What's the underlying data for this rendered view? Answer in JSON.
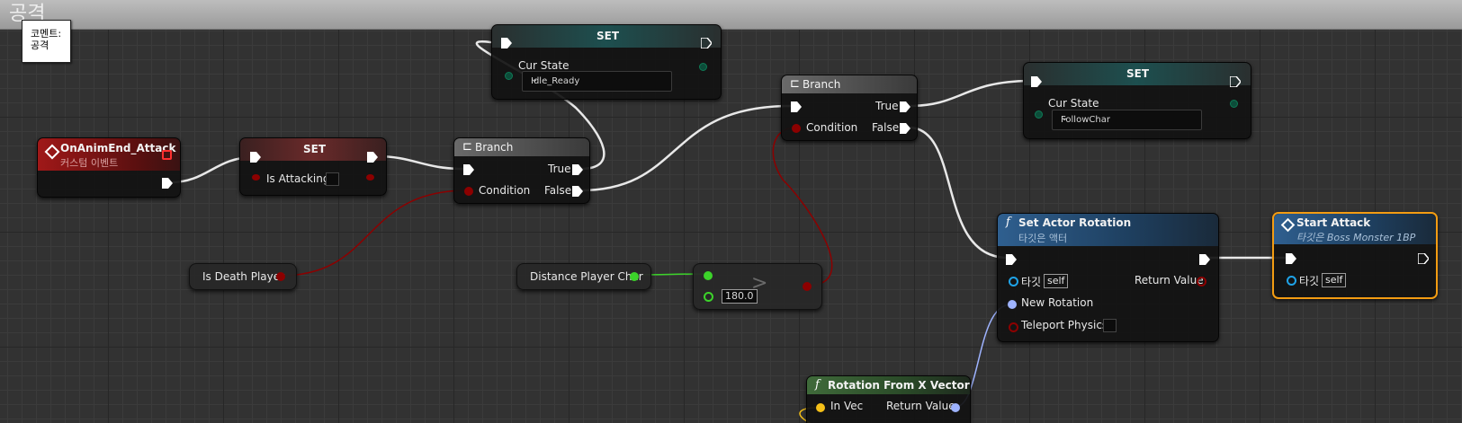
{
  "comment": {
    "title": "공격",
    "tooltip_line1": "코멘트:",
    "tooltip_line2": "공격"
  },
  "event_node": {
    "title": "OnAnimEnd_Attack",
    "subtitle": "커스텀 이벤트",
    "color": "#8b1a1a"
  },
  "set_attacking": {
    "title": "SET",
    "var_label": "Is Attacking"
  },
  "branch1": {
    "title": "Branch",
    "true_label": "True",
    "false_label": "False",
    "condition_label": "Condition"
  },
  "set_idle": {
    "title": "SET",
    "var_label": "Cur State",
    "value": "Idle_Ready"
  },
  "branch2": {
    "title": "Branch",
    "true_label": "True",
    "false_label": "False",
    "condition_label": "Condition"
  },
  "set_follow": {
    "title": "SET",
    "var_label": "Cur State",
    "value": "FollowChar"
  },
  "is_death_player": {
    "label": "Is Death Player"
  },
  "distance_player_char": {
    "label": "Distance Player Char"
  },
  "compare_node": {
    "operator": ">",
    "value": "180.0"
  },
  "set_actor_rotation": {
    "title": "Set Actor Rotation",
    "subtitle": "타깃은 액터",
    "target_label": "타깃",
    "target_value": "self",
    "return_label": "Return Value",
    "new_rotation_label": "New Rotation",
    "teleport_label": "Teleport Physics"
  },
  "start_attack": {
    "title": "Start Attack",
    "subtitle": "타깃은 Boss Monster 1BP",
    "target_label": "타깃",
    "target_value": "self"
  },
  "rotation_from_x": {
    "title": "Rotation From X Vector",
    "in_label": "In Vec",
    "return_label": "Return Value"
  },
  "colors": {
    "exec": "#ffffff",
    "bool": "#8c0000",
    "float": "#3cd32a",
    "rotator": "#9eb3ff",
    "object": "#1fa3e8",
    "vector": "#f5c018",
    "selected": "#f39c12"
  }
}
